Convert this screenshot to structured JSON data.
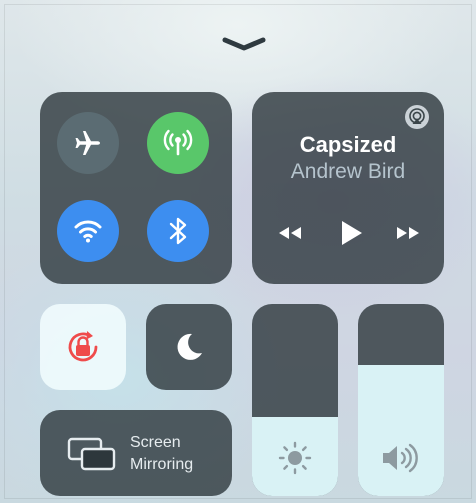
{
  "control_center": {
    "dismiss_icon": "chevron-down-icon",
    "connectivity": {
      "airplane": {
        "icon": "airplane-icon",
        "state": "off"
      },
      "cellular": {
        "icon": "antenna-icon",
        "state": "on",
        "color": "#59c76a"
      },
      "wifi": {
        "icon": "wifi-icon",
        "state": "on",
        "color": "#3d8ef0"
      },
      "bluetooth": {
        "icon": "bluetooth-icon",
        "state": "on",
        "color": "#3d8ef0"
      }
    },
    "now_playing": {
      "title": "Capsized",
      "artist": "Andrew Bird",
      "airplay_icon": "airplay-icon",
      "controls": [
        "rewind-icon",
        "play-icon",
        "fast-forward-icon"
      ]
    },
    "rotation_lock": {
      "icon": "rotation-lock-icon",
      "color": "#ef4b4b"
    },
    "do_not_disturb": {
      "icon": "moon-icon"
    },
    "screen_mirroring": {
      "icon": "screen-mirroring-icon",
      "label_line1": "Screen",
      "label_line2": "Mirroring"
    },
    "brightness": {
      "icon": "sun-icon",
      "level": 0.41
    },
    "volume": {
      "icon": "speaker-icon",
      "level": 0.68
    }
  }
}
